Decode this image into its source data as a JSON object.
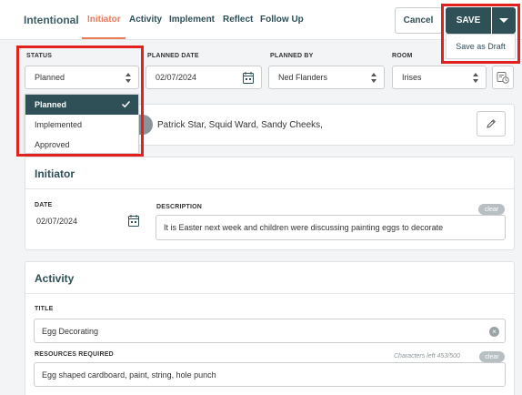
{
  "nav": {
    "brand": "Intentional",
    "tabs": [
      "Initiator",
      "Activity",
      "Implement",
      "Reflect",
      "Follow Up"
    ],
    "active_tab": "Initiator"
  },
  "actions": {
    "cancel_label": "Cancel",
    "save_label": "SAVE",
    "save_menu_item": "Save as Draft"
  },
  "fields": {
    "status": {
      "label": "STATUS",
      "value": "Planned",
      "options": [
        "Planned",
        "Implemented",
        "Approved"
      ],
      "selected": "Planned"
    },
    "planned_date": {
      "label": "PLANNED DATE",
      "value": "02/07/2024"
    },
    "planned_by": {
      "label": "PLANNED BY",
      "value": "Ned Flanders"
    },
    "room": {
      "label": "ROOM",
      "value": "Irises"
    }
  },
  "participants": {
    "text": "Patrick Star, Squid Ward, Sandy Cheeks,"
  },
  "initiator": {
    "title": "Initiator",
    "date_label": "DATE",
    "date_value": "02/07/2024",
    "description_label": "DESCRIPTION",
    "description_value": "It is Easter next week and children were discussing painting eggs to decorate",
    "clear_label": "clear"
  },
  "activity": {
    "title": "Activity",
    "title_label": "TITLE",
    "title_value": "Egg Decorating",
    "resources_label": "RESOURCES REQUIRED",
    "chars_left": "Characters left 453/500",
    "clear_label": "clear",
    "resources_value": "Egg shaped cardboard, paint, string, hole punch"
  },
  "colors": {
    "accent": "#ea7a5a",
    "primary": "#2f5057",
    "highlight": "#e2201d"
  }
}
